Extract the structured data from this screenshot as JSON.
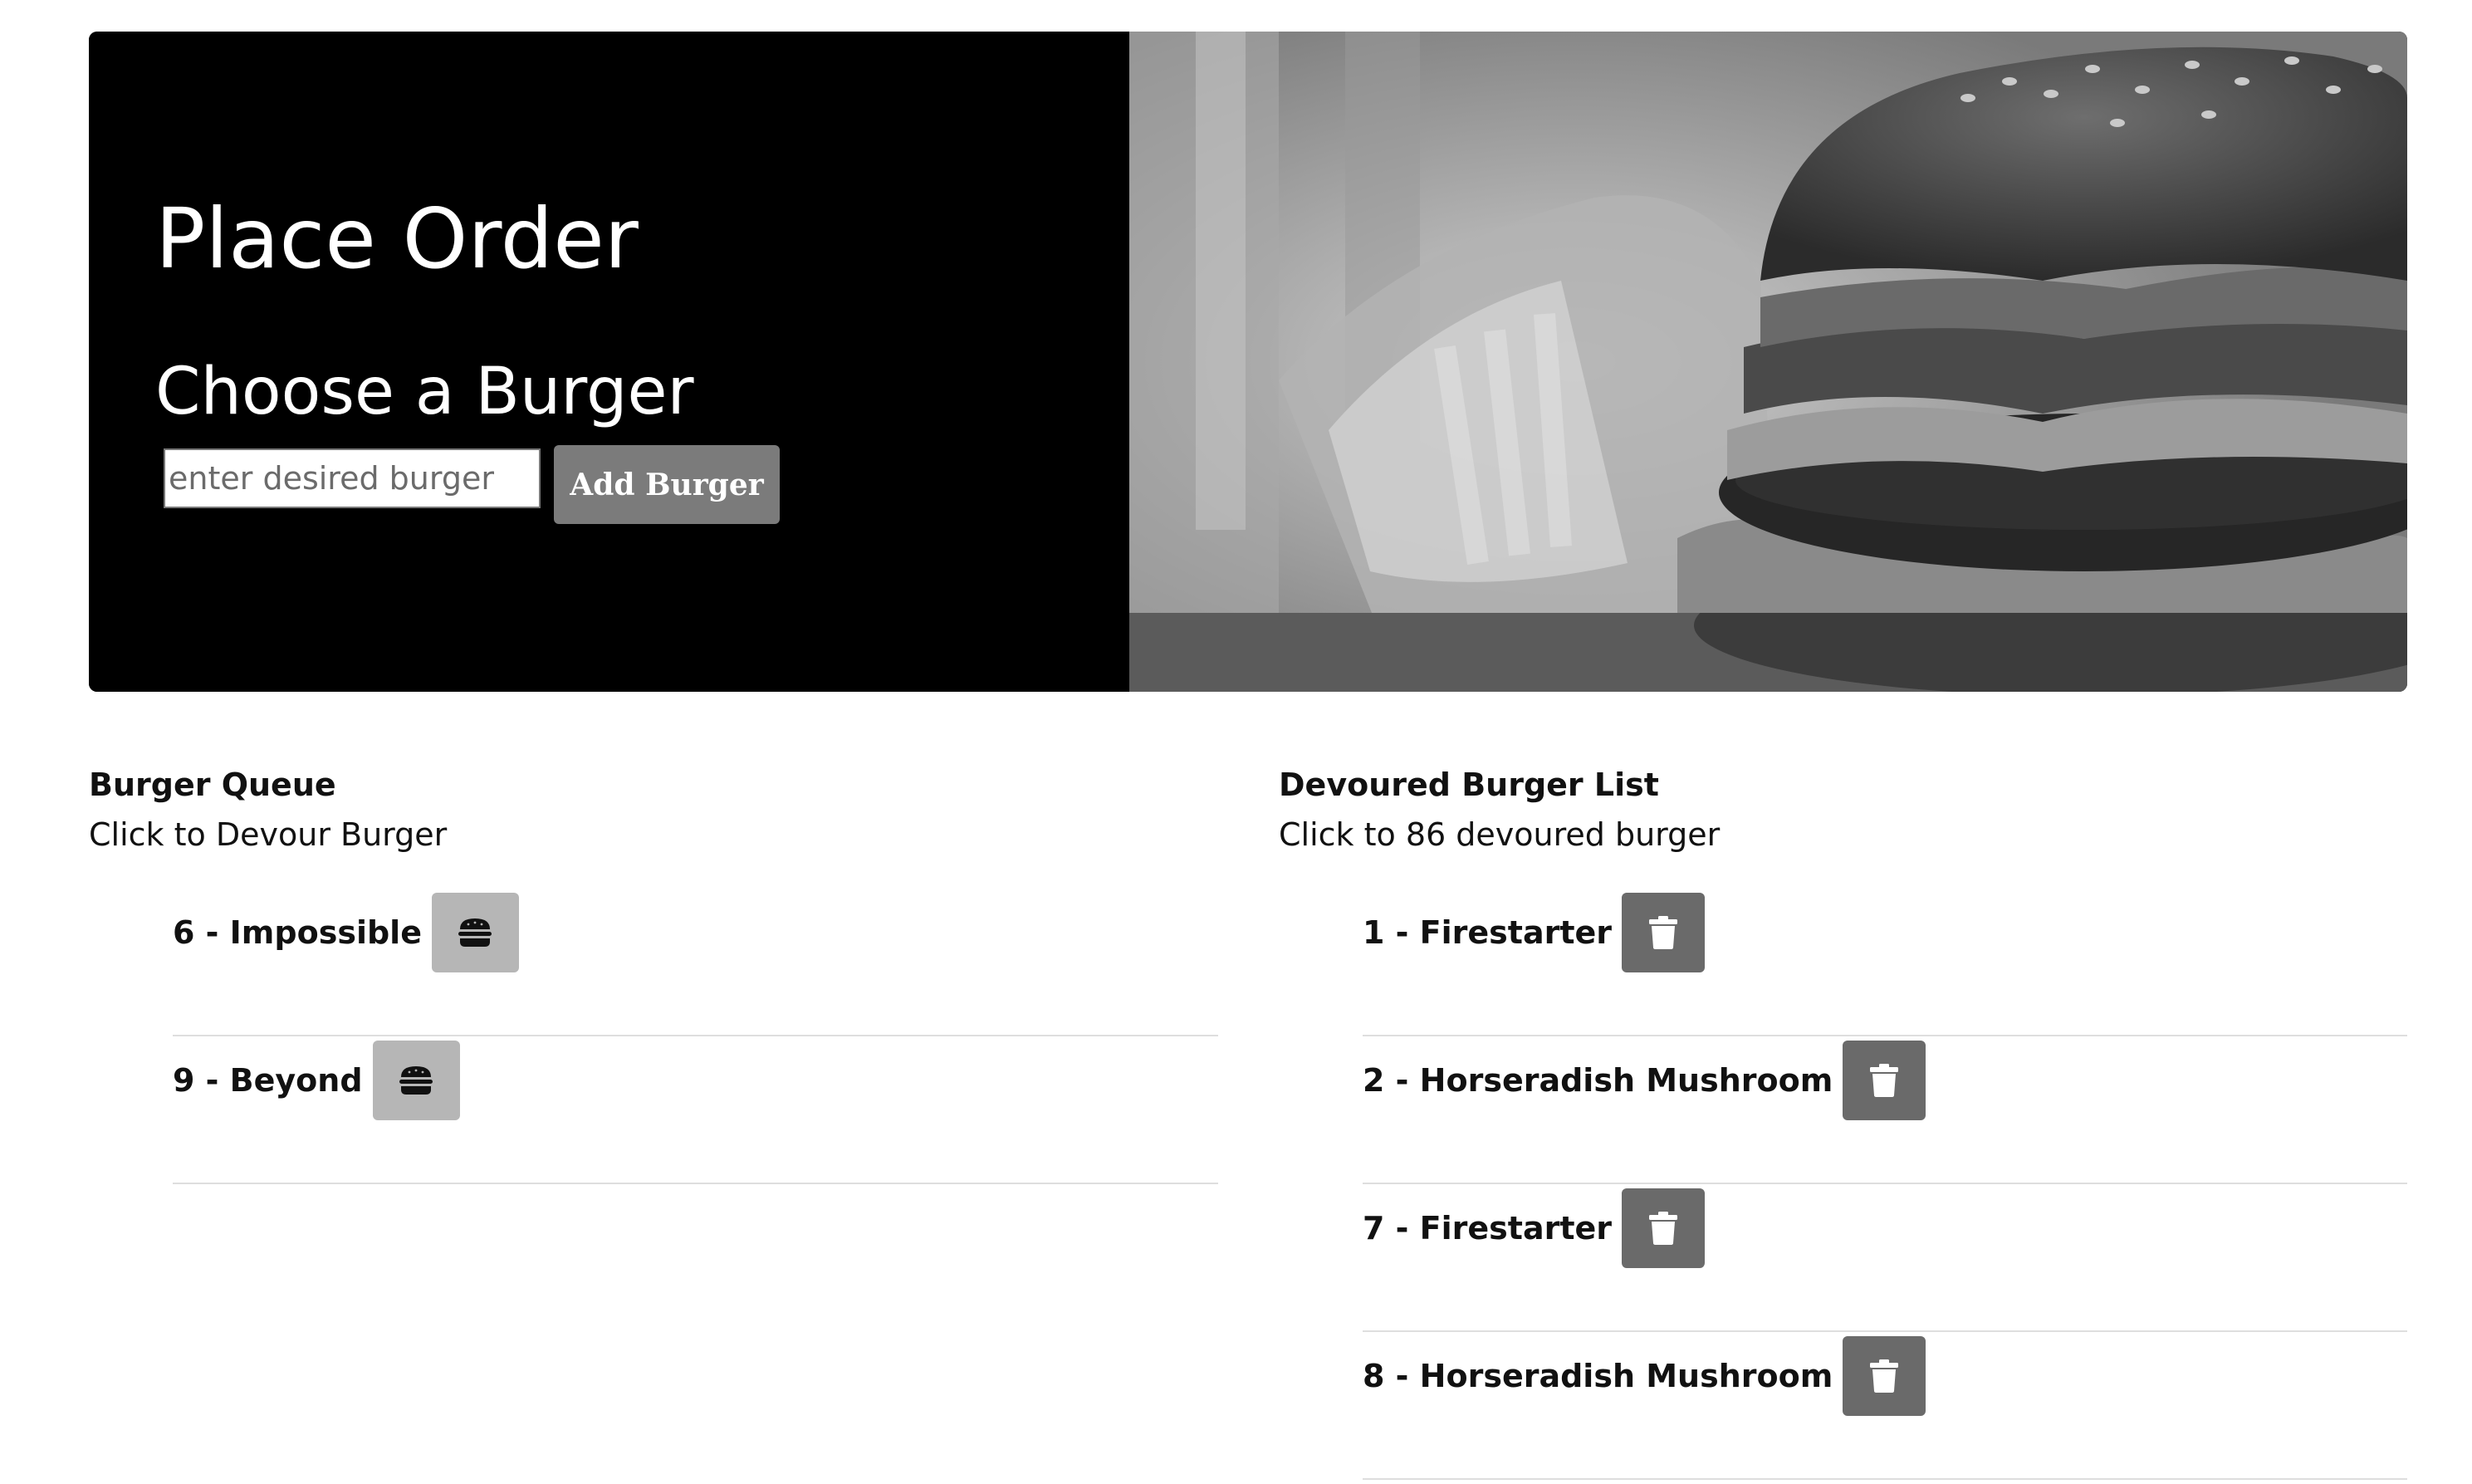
{
  "hero": {
    "title": "Place Order",
    "subtitle": "Choose a Burger",
    "input": {
      "placeholder": "enter desired burger",
      "value": ""
    },
    "add_button_label": "Add Burger",
    "image_icon": "burger-photo"
  },
  "queue": {
    "heading": "Burger Queue",
    "subheading": "Click to Devour Burger",
    "items": [
      {
        "label": "6 - Impossible",
        "icon": "burger-icon"
      },
      {
        "label": "9 - Beyond",
        "icon": "burger-icon"
      }
    ]
  },
  "devoured": {
    "heading": "Devoured Burger List",
    "subheading": "Click to 86 devoured burger",
    "items": [
      {
        "label": "1 - Firestarter",
        "icon": "trash-icon"
      },
      {
        "label": "2 - Horseradish Mushroom",
        "icon": "trash-icon"
      },
      {
        "label": "7 - Firestarter",
        "icon": "trash-icon"
      },
      {
        "label": "8 - Horseradish Mushroom",
        "icon": "trash-icon"
      }
    ]
  },
  "colors": {
    "hero_bg": "#000000",
    "add_button": "#7b7b7b",
    "devour_button": "#b6b6b6",
    "trash_button": "#6a6a6a",
    "divider": "#dedede"
  }
}
